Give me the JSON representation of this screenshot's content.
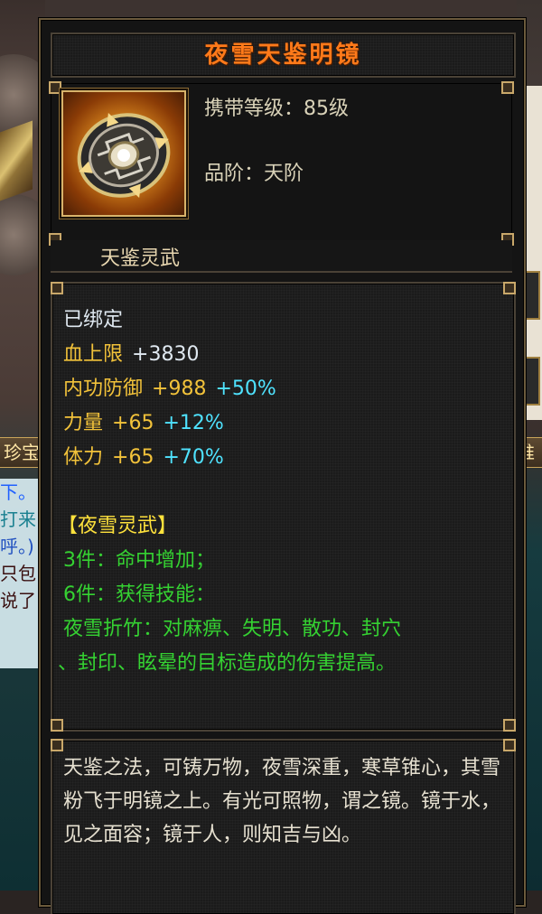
{
  "tooltip": {
    "title": "夜雪天鉴明镜",
    "info": {
      "level": "携带等级：85级",
      "grade": "品阶：天阶"
    },
    "type_label": "天鉴灵武",
    "bound": "已绑定",
    "stats": [
      {
        "name": "血上限",
        "value": "+3830",
        "percent": ""
      },
      {
        "name": "内功防御",
        "value": "+988",
        "percent": "+50%"
      },
      {
        "name": "力量",
        "value": "+65",
        "percent": "+12%"
      },
      {
        "name": "体力",
        "value": "+65",
        "percent": "+70%"
      }
    ],
    "set": {
      "title": "【夜雪灵武】",
      "bonus3": "3件：命中增加；",
      "bonus6": "6件：获得技能：",
      "skill_line1": "夜雪折竹：对麻痹、失明、散功、封穴",
      "skill_line2": "、封印、眩晕的目标造成的伤害提高。"
    },
    "description": "天鉴之法，可铸万物，夜雪深重，寒草锥心，其雪粉飞于明镜之上。有光可照物，谓之镜。镜于水，见之面容；镜于人，则知吉与凶。"
  },
  "background": {
    "left_tab": "珍宝",
    "right_tab": "推",
    "chat_lines": [
      "下。",
      "打来!",
      "呼。)",
      "只包",
      "说了"
    ]
  },
  "colors": {
    "title": "#ff7a1a",
    "stat_name": "#f2c23a",
    "stat_percent": "#4fe3ff",
    "set_text": "#35d232",
    "set_title": "#ffe23c"
  },
  "icons": {
    "item": "mirror-artifact-icon"
  }
}
